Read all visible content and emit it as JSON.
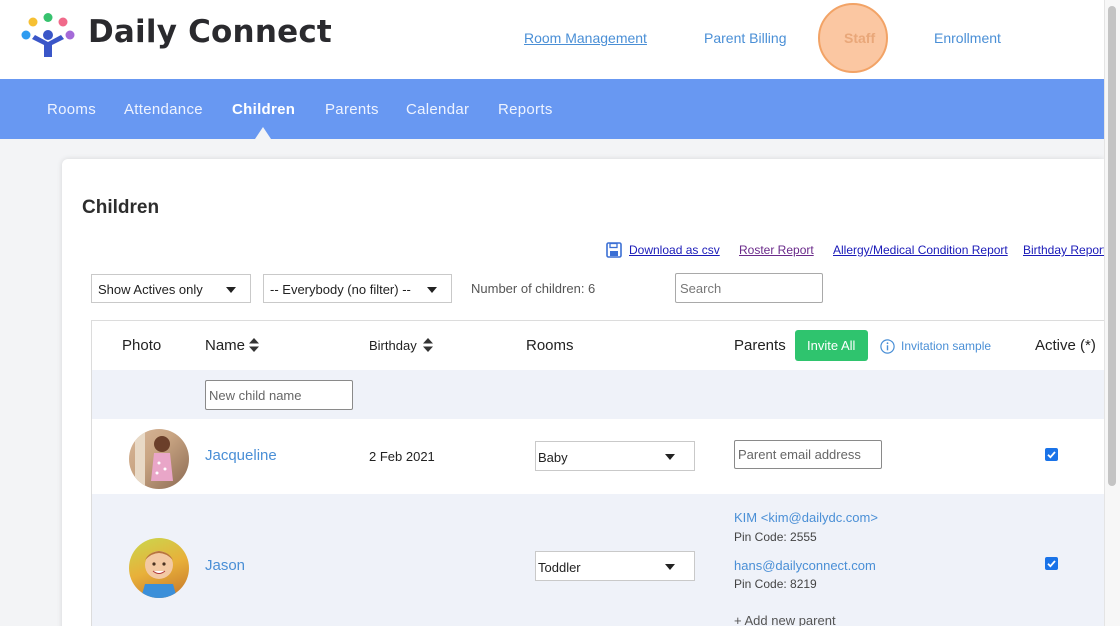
{
  "header": {
    "brand": "Daily Connect",
    "links": {
      "room_management": "Room Management",
      "parent_billing": "Parent Billing",
      "staff": "Staff",
      "enrollment": "Enrollment"
    }
  },
  "nav": {
    "items": [
      "Rooms",
      "Attendance",
      "Children",
      "Parents",
      "Calendar",
      "Reports"
    ],
    "active": "Children"
  },
  "page": {
    "title": "Children",
    "reports": {
      "download_csv": "Download as csv",
      "roster": "Roster Report",
      "allergy": "Allergy/Medical Condition Report",
      "birthday": "Birthday Report"
    },
    "filters": {
      "status": "Show Actives only",
      "group": "-- Everybody (no filter) --",
      "count_label": "Number of children: 6",
      "search_placeholder": "Search"
    }
  },
  "table": {
    "headers": {
      "photo": "Photo",
      "name": "Name",
      "birthday": "Birthday",
      "rooms": "Rooms",
      "parents": "Parents",
      "invite_all": "Invite All",
      "invitation_sample": "Invitation sample",
      "active": "Active (*)"
    },
    "new_child_placeholder": "New child name",
    "parent_email_placeholder": "Parent email address",
    "rows": [
      {
        "name": "Jacqueline",
        "birthday": "2 Feb 2021",
        "room": "Baby",
        "active": true
      },
      {
        "name": "Jason",
        "birthday": "",
        "room": "Toddler",
        "parents": [
          {
            "contact": "KIM <kim@dailydc.com>",
            "pin": "Pin Code: 2555"
          },
          {
            "contact": "hans@dailyconnect.com",
            "pin": "Pin Code: 8219"
          }
        ],
        "add_parent": "+ Add new parent",
        "active": true
      }
    ]
  },
  "colors": {
    "nav_bg": "#6898f2",
    "link": "#4a8fd6",
    "invite_btn": "#2fc46e",
    "staff_highlight": "#fbc7a2",
    "row_alt": "#eff2f9"
  },
  "icons": [
    "daily-connect-logo",
    "floppy-disk-icon",
    "sort-icon",
    "info-icon",
    "checkbox-checked-icon"
  ]
}
